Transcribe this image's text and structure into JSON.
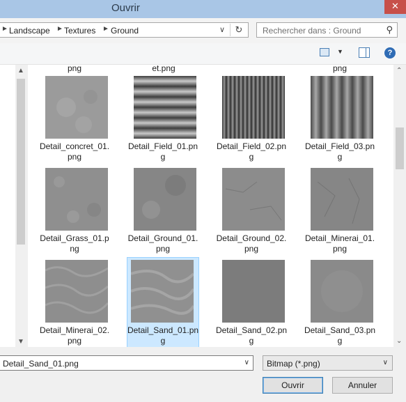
{
  "window": {
    "title": "Ouvrir",
    "close_symbol": "✕"
  },
  "address": {
    "crumbs": [
      "Landscape",
      "Textures",
      "Ground"
    ],
    "search_placeholder": "Rechercher dans : Ground"
  },
  "files": {
    "partial_labels": [
      "png",
      "et.png",
      "png"
    ],
    "items": [
      {
        "label": "Detail_concret_01.png",
        "tile": "concrete"
      },
      {
        "label": "Detail_Field_01.png",
        "tile": "field1"
      },
      {
        "label": "Detail_Field_02.png",
        "tile": "field2"
      },
      {
        "label": "Detail_Field_03.png",
        "tile": "field3"
      },
      {
        "label": "Detail_Grass_01.png",
        "tile": "grass"
      },
      {
        "label": "Detail_Ground_01.png",
        "tile": "ground1"
      },
      {
        "label": "Detail_Ground_02.png",
        "tile": "ground2"
      },
      {
        "label": "Detail_Minerai_01.png",
        "tile": "minerai1"
      },
      {
        "label": "Detail_Minerai_02.png",
        "tile": "minerai2"
      },
      {
        "label": "Detail_Sand_01.png",
        "tile": "sand1",
        "selected": true
      },
      {
        "label": "Detail_Sand_02.png",
        "tile": "sand2"
      },
      {
        "label": "Detail_Sand_03.png",
        "tile": "sand3"
      }
    ]
  },
  "footer": {
    "filename_value": "Detail_Sand_01.png",
    "filetype_value": "Bitmap (*.png)",
    "open_label": "Ouvrir",
    "cancel_label": "Annuler"
  },
  "colors": {
    "selection": "#cce8ff",
    "selection_border": "#99d1ff",
    "titlebar": "#a9c6e6",
    "close": "#c7504a"
  }
}
